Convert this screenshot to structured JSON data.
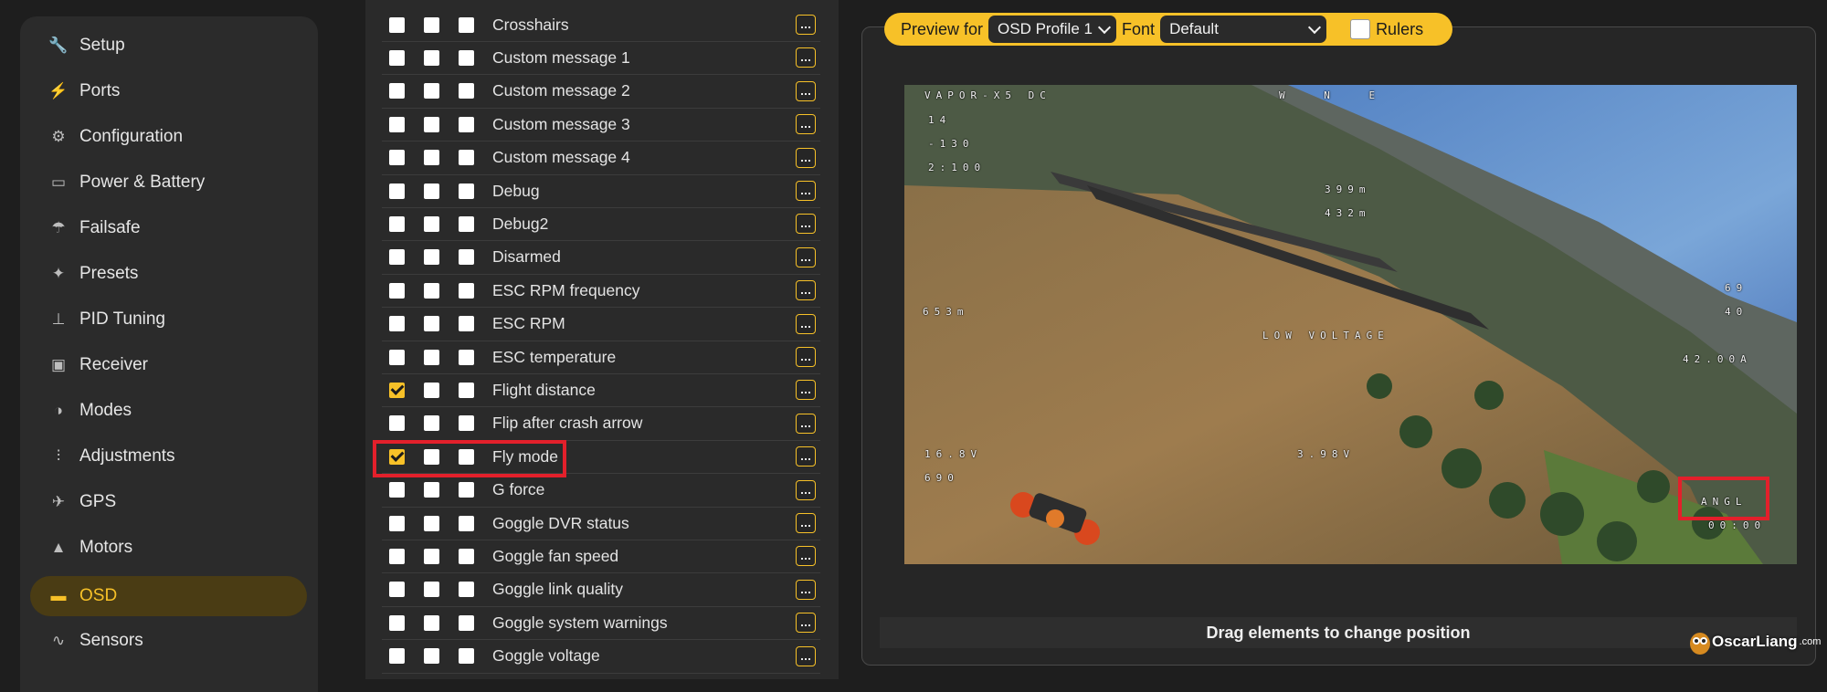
{
  "sidebar": {
    "items": [
      {
        "label": "Setup",
        "icon": "wrench-icon",
        "glyph": "🔧"
      },
      {
        "label": "Ports",
        "icon": "plug-icon",
        "glyph": "⚡"
      },
      {
        "label": "Configuration",
        "icon": "gear-icon",
        "glyph": "⚙"
      },
      {
        "label": "Power & Battery",
        "icon": "battery-icon",
        "glyph": "▭"
      },
      {
        "label": "Failsafe",
        "icon": "parachute-icon",
        "glyph": "☂"
      },
      {
        "label": "Presets",
        "icon": "wand-icon",
        "glyph": "✦"
      },
      {
        "label": "PID Tuning",
        "icon": "sitemap-icon",
        "glyph": "⊥"
      },
      {
        "label": "Receiver",
        "icon": "robot-icon",
        "glyph": "▣"
      },
      {
        "label": "Modes",
        "icon": "toggle-icon",
        "glyph": "◑"
      },
      {
        "label": "Adjustments",
        "icon": "sliders-icon",
        "glyph": "⫶"
      },
      {
        "label": "GPS",
        "icon": "satellite-icon",
        "glyph": "✈"
      },
      {
        "label": "Motors",
        "icon": "motor-icon",
        "glyph": "▲"
      },
      {
        "label": "OSD",
        "icon": "osd-icon",
        "glyph": "▬",
        "active": true
      },
      {
        "label": "Sensors",
        "icon": "pulse-icon",
        "glyph": "∿"
      }
    ]
  },
  "elements": {
    "rows": [
      {
        "label": "Crosshairs",
        "checked": [
          false,
          false,
          false
        ]
      },
      {
        "label": "Custom message 1",
        "checked": [
          false,
          false,
          false
        ]
      },
      {
        "label": "Custom message 2",
        "checked": [
          false,
          false,
          false
        ]
      },
      {
        "label": "Custom message 3",
        "checked": [
          false,
          false,
          false
        ]
      },
      {
        "label": "Custom message 4",
        "checked": [
          false,
          false,
          false
        ]
      },
      {
        "label": "Debug",
        "checked": [
          false,
          false,
          false
        ]
      },
      {
        "label": "Debug2",
        "checked": [
          false,
          false,
          false
        ]
      },
      {
        "label": "Disarmed",
        "checked": [
          false,
          false,
          false
        ]
      },
      {
        "label": "ESC RPM frequency",
        "checked": [
          false,
          false,
          false
        ]
      },
      {
        "label": "ESC RPM",
        "checked": [
          false,
          false,
          false
        ]
      },
      {
        "label": "ESC temperature",
        "checked": [
          false,
          false,
          false
        ]
      },
      {
        "label": "Flight distance",
        "checked": [
          true,
          false,
          false
        ]
      },
      {
        "label": "Flip after crash arrow",
        "checked": [
          false,
          false,
          false
        ]
      },
      {
        "label": "Fly mode",
        "checked": [
          true,
          false,
          false
        ]
      },
      {
        "label": "G force",
        "checked": [
          false,
          false,
          false
        ]
      },
      {
        "label": "Goggle DVR status",
        "checked": [
          false,
          false,
          false
        ]
      },
      {
        "label": "Goggle fan speed",
        "checked": [
          false,
          false,
          false
        ]
      },
      {
        "label": "Goggle link quality",
        "checked": [
          false,
          false,
          false
        ]
      },
      {
        "label": "Goggle system warnings",
        "checked": [
          false,
          false,
          false
        ]
      },
      {
        "label": "Goggle voltage",
        "checked": [
          false,
          false,
          false
        ]
      }
    ]
  },
  "preview": {
    "preview_for_label": "Preview for",
    "profile_value": "OSD Profile 1",
    "font_label": "Font",
    "font_value": "Default",
    "rulers_label": "Rulers",
    "rulers_checked": false,
    "drag_hint": "Drag elements to change position"
  },
  "osd": {
    "craft_name": "VAPOR-X5 DC",
    "sats": "14",
    "rssi": "-130",
    "link": "2:100",
    "compass": "W N E",
    "altitude": "399m",
    "home_distance": "432m",
    "distance_flown": "653m",
    "speed": "69",
    "speed2": "40",
    "current": "42.00A",
    "warning": "LOW VOLTAGE",
    "battery_voltage": "16.8V",
    "mah": "690",
    "cell_voltage": "3.98V",
    "fly_mode": "ANGL",
    "timer": "00:00"
  },
  "watermark": {
    "text": "OscarLiang",
    "domain": ".com"
  },
  "colors": {
    "accent": "#f7c128",
    "highlight": "#e3202b",
    "active_nav_bg": "#4a3c14"
  }
}
